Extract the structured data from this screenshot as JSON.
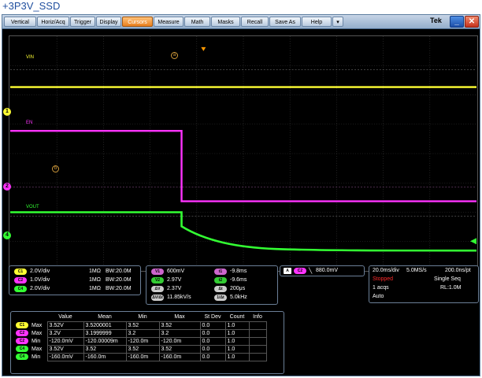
{
  "page_title": "+3P3V_SSD",
  "menu": [
    {
      "label": "Vertical",
      "name": "menu-vertical"
    },
    {
      "label": "Horiz/Acq",
      "name": "menu-horiz-acq"
    },
    {
      "label": "Trigger",
      "name": "menu-trigger"
    },
    {
      "label": "Display",
      "name": "menu-display"
    },
    {
      "label": "Cursors",
      "name": "menu-cursors"
    },
    {
      "label": "Measure",
      "name": "menu-measure"
    },
    {
      "label": "Math",
      "name": "menu-math"
    },
    {
      "label": "Masks",
      "name": "menu-masks"
    },
    {
      "label": "Recall",
      "name": "menu-recall"
    },
    {
      "label": "Save As",
      "name": "menu-save-as"
    },
    {
      "label": "Help",
      "name": "menu-help"
    },
    {
      "label": "▾",
      "name": "menu-more"
    }
  ],
  "brand": "Tek",
  "window": {
    "minimize": "_",
    "close": "✕"
  },
  "traces": {
    "vin": {
      "label": "VIN",
      "color": "#ffff33"
    },
    "en": {
      "label": "EN",
      "color": "#ff33ff"
    },
    "vout": {
      "label": "VOUT",
      "color": "#33ff33"
    }
  },
  "markers": {
    "ch1": "1",
    "ch2": "2",
    "ch4": "4",
    "cursor_a": "a",
    "cursor_b": "b"
  },
  "channels": [
    {
      "chip": "C1",
      "color": "#ffff33",
      "scale": "2.0V/div",
      "coupling": "1MΩ",
      "bw": "BW:20.0M"
    },
    {
      "chip": "C2",
      "color": "#ff33ff",
      "scale": "1.0V/div",
      "coupling": "1MΩ",
      "bw": "BW:20.0M"
    },
    {
      "chip": "C4",
      "color": "#33ff33",
      "scale": "2.0V/div",
      "coupling": "1MΩ",
      "bw": "BW:20.0M"
    }
  ],
  "cursors": {
    "v1": {
      "chip": "V1",
      "value": "600mV"
    },
    "v2": {
      "chip": "V2",
      "value": "2.97V"
    },
    "dv": {
      "chip": "ΔV",
      "value": "2.37V"
    },
    "dvdt": {
      "chip": "ΔV/Δt",
      "value": "11.85kV/s"
    },
    "t1": {
      "chip": "t1",
      "value": "-9.8ms"
    },
    "t2": {
      "chip": "t2",
      "value": "-9.6ms"
    },
    "dt": {
      "chip": "Δt",
      "value": "200μs"
    },
    "inv": {
      "chip": "1/Δt",
      "value": "5.0kHz"
    }
  },
  "trigger": {
    "chip_a": "A",
    "chip_src": "C2",
    "slope": "╲",
    "level": "880.0mV"
  },
  "acquisition": {
    "timebase": "20.0ms/div",
    "sample_rate": "5.0MS/s",
    "resolution": "200.0ns/pt",
    "state": "Stopped",
    "mode": "Single Seq",
    "acqs": "1 acqs",
    "record_length": "RL:1.0M",
    "trigger_mode": "Auto"
  },
  "measurements": {
    "headers": [
      "Value",
      "Mean",
      "Min",
      "Max",
      "St Dev",
      "Count",
      "Info"
    ],
    "rows": [
      {
        "chip": "C1",
        "color": "#ffff33",
        "label": "Max",
        "cells": [
          "3.52V",
          "3.5200001",
          "3.52",
          "3.52",
          "0.0",
          "1.0",
          ""
        ]
      },
      {
        "chip": "C2",
        "color": "#ff33ff",
        "label": "Max",
        "cells": [
          "3.2V",
          "3.1999999",
          "3.2",
          "3.2",
          "0.0",
          "1.0",
          ""
        ]
      },
      {
        "chip": "C2",
        "color": "#ff33ff",
        "label": "Min",
        "cells": [
          "-120.0mV",
          "-120.00009m",
          "-120.0m",
          "-120.0m",
          "0.0",
          "1.0",
          ""
        ]
      },
      {
        "chip": "C4",
        "color": "#33ff33",
        "label": "Max",
        "cells": [
          "3.52V",
          "3.52",
          "3.52",
          "3.52",
          "0.0",
          "1.0",
          ""
        ]
      },
      {
        "chip": "C4",
        "color": "#33ff33",
        "label": "Min",
        "cells": [
          "-160.0mV",
          "-160.0m",
          "-160.0m",
          "-160.0m",
          "0.0",
          "1.0",
          ""
        ]
      }
    ]
  },
  "colors": {
    "accent_tab": "#e9801e",
    "trigger_marker": "#ff9900"
  }
}
